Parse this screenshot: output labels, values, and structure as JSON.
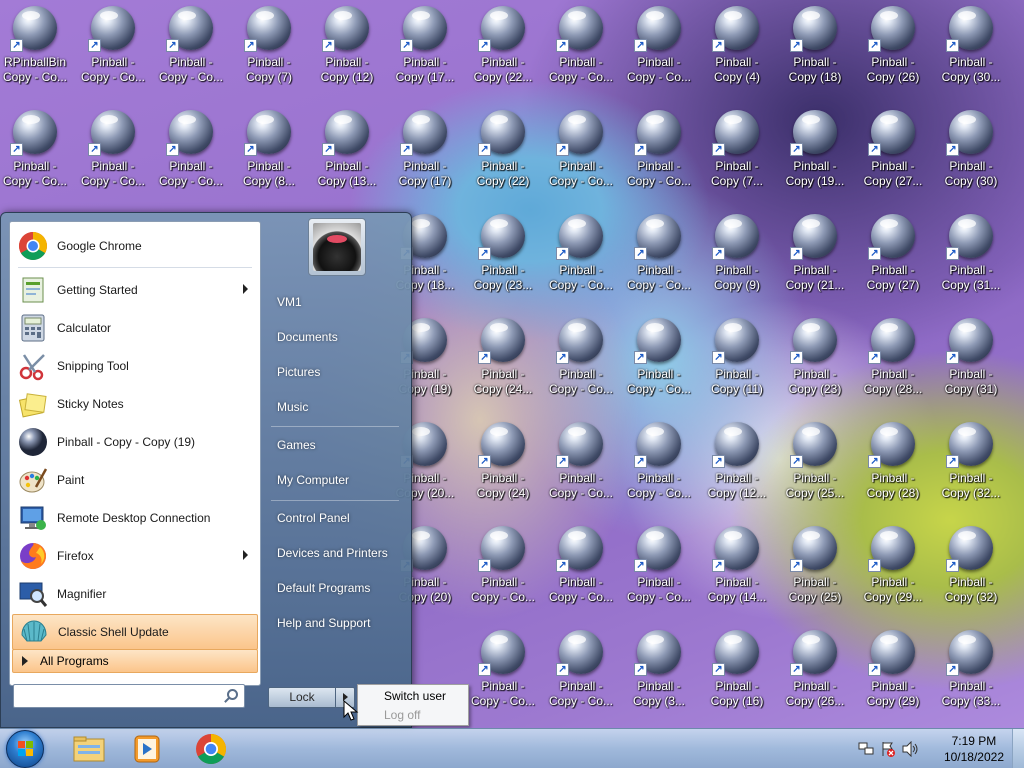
{
  "desktop": {
    "icons": [
      [
        "RPinballBin\nCopy - Co...",
        "Pinball -\nCopy - Co...",
        "Pinball -\nCopy - Co...",
        "Pinball -\nCopy (7)",
        "Pinball -\nCopy (12)",
        "Pinball -\nCopy (17...",
        "Pinball -\nCopy (22...",
        "Pinball -\nCopy - Co...",
        "Pinball -\nCopy - Co...",
        "Pinball -\nCopy (4)",
        "Pinball -\nCopy (18)",
        "Pinball -\nCopy (26)",
        "Pinball -\nCopy (30..."
      ],
      [
        "Pinball -\nCopy - Co...",
        "Pinball -\nCopy - Co...",
        "Pinball -\nCopy - Co...",
        "Pinball -\nCopy (8...",
        "Pinball -\nCopy (13...",
        "Pinball -\nCopy (17)",
        "Pinball -\nCopy (22)",
        "Pinball -\nCopy - Co...",
        "Pinball -\nCopy - Co...",
        "Pinball -\nCopy (7...",
        "Pinball -\nCopy (19...",
        "Pinball -\nCopy (27...",
        "Pinball -\nCopy (30)"
      ],
      [
        "",
        "",
        "",
        "",
        "",
        "Pinball -\nCopy (18...",
        "Pinball -\nCopy (23...",
        "Pinball -\nCopy - Co...",
        "Pinball -\nCopy - Co...",
        "Pinball -\nCopy (9)",
        "Pinball -\nCopy (21...",
        "Pinball -\nCopy (27)",
        "Pinball -\nCopy (31..."
      ],
      [
        "",
        "",
        "",
        "",
        "",
        "Pinball -\nCopy (19)",
        "Pinball -\nCopy (24...",
        "Pinball -\nCopy - Co...",
        "Pinball -\nCopy - Co...",
        "Pinball -\nCopy (11)",
        "Pinball -\nCopy (23)",
        "Pinball -\nCopy (28...",
        "Pinball -\nCopy (31)"
      ],
      [
        "",
        "",
        "",
        "",
        "",
        "Pinball -\nCopy (20...",
        "Pinball -\nCopy (24)",
        "Pinball -\nCopy - Co...",
        "Pinball -\nCopy - Co...",
        "Pinball -\nCopy (12...",
        "Pinball -\nCopy (25...",
        "Pinball -\nCopy (28)",
        "Pinball -\nCopy (32..."
      ],
      [
        "",
        "",
        "",
        "",
        "",
        "Pinball -\nCopy (20)",
        "Pinball -\nCopy - Co...",
        "Pinball -\nCopy - Co...",
        "Pinball -\nCopy - Co...",
        "Pinball -\nCopy (14...",
        "Pinball -\nCopy (25)",
        "Pinball -\nCopy (29...",
        "Pinball -\nCopy (32)"
      ],
      [
        "",
        "",
        "",
        "",
        "",
        "",
        "Pinball -\nCopy - Co...",
        "Pinball -\nCopy - Co...",
        "Pinball -\nCopy (3...",
        "Pinball -\nCopy (16)",
        "Pinball -\nCopy (26...",
        "Pinball -\nCopy (29)",
        "Pinball -\nCopy (33..."
      ]
    ]
  },
  "start_menu": {
    "programs": [
      {
        "label": "Google Chrome",
        "icon": "chrome-icon"
      },
      {
        "label": "Getting Started",
        "icon": "getting-started-icon",
        "submenu": true
      },
      {
        "label": "Calculator",
        "icon": "calculator-icon"
      },
      {
        "label": "Snipping Tool",
        "icon": "scissors-icon"
      },
      {
        "label": "Sticky Notes",
        "icon": "sticky-notes-icon"
      },
      {
        "label": "Pinball - Copy - Copy (19)",
        "icon": "pinball-icon"
      },
      {
        "label": "Paint",
        "icon": "paint-palette-icon"
      },
      {
        "label": "Remote Desktop Connection",
        "icon": "remote-desktop-icon"
      },
      {
        "label": "Firefox",
        "icon": "firefox-icon",
        "submenu": true
      },
      {
        "label": "Magnifier",
        "icon": "magnifier-icon"
      },
      {
        "label": "Classic Shell Update",
        "icon": "shell-icon"
      }
    ],
    "all_programs": "All Programs",
    "search": {
      "placeholder": "",
      "value": ""
    },
    "right_links": [
      "VM1",
      "Documents",
      "Pictures",
      "Music",
      "Games",
      "My Computer",
      "Control Panel",
      "Devices and Printers",
      "Default Programs",
      "Help and Support"
    ],
    "shutdown_button": "Lock",
    "context_menu": {
      "switch_user": "Switch user",
      "log_off": "Log off"
    }
  },
  "taskbar": {
    "pinned": [
      "explorer-icon",
      "media-player-icon",
      "chrome-icon"
    ],
    "clock_time": "7:19 PM",
    "clock_date": "10/18/2022"
  },
  "colors": {
    "highlight": "#fbc58b",
    "taskbar": "#a9c2dd"
  }
}
